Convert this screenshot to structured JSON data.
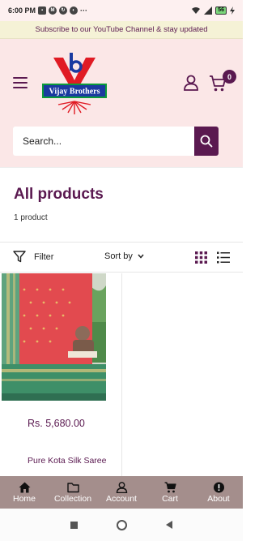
{
  "status_bar": {
    "time": "6:00 PM",
    "more": "···",
    "battery": "56"
  },
  "announcement": {
    "text": "Subscribe to our YouTube Channel & stay updated"
  },
  "header": {
    "logo_text": "Vijay Brothers",
    "cart_count": "0",
    "search_placeholder": "Search..."
  },
  "collection": {
    "title": "All products",
    "count": "1 product"
  },
  "toolbar": {
    "filter_label": "Filter",
    "sort_label": "Sort by"
  },
  "products": [
    {
      "price": "Rs. 5,680.00",
      "name": "Pure Kota Silk Saree"
    }
  ],
  "bottom_nav": {
    "items": [
      {
        "label": "Home",
        "icon": "home-icon"
      },
      {
        "label": "Collection",
        "icon": "folder-icon"
      },
      {
        "label": "Account",
        "icon": "user-icon"
      },
      {
        "label": "Cart",
        "icon": "cart-icon"
      },
      {
        "label": "About",
        "icon": "info-icon"
      }
    ]
  },
  "colors": {
    "brand": "#5a1950",
    "header_bg": "#fbe7e7",
    "announcement_bg": "#f5f2d6",
    "bottom_nav_bg": "#a48e8c"
  }
}
